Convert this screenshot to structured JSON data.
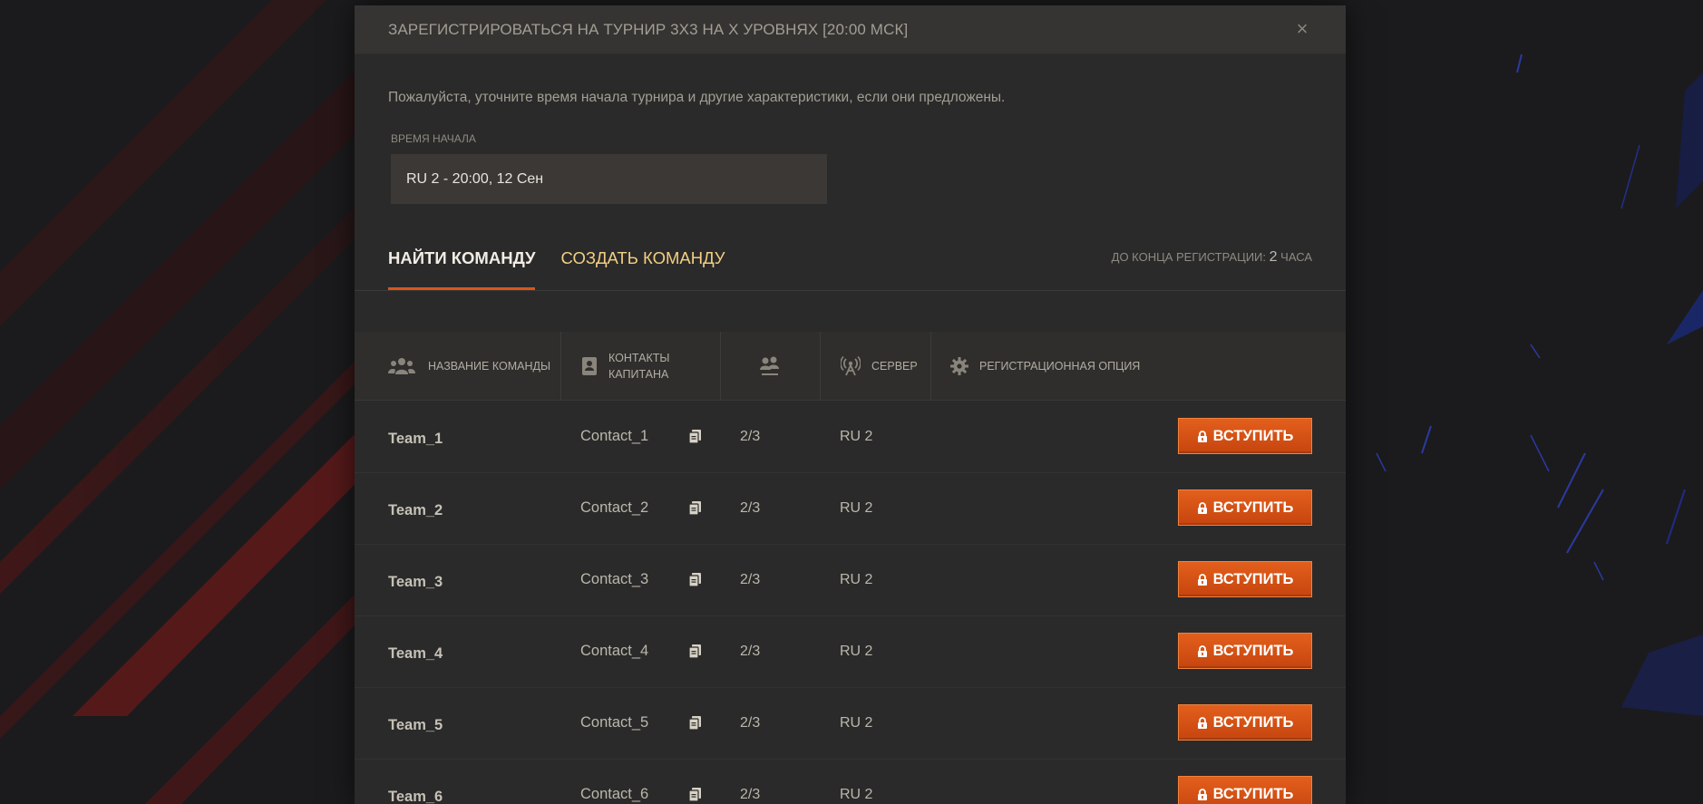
{
  "modal": {
    "title": "ЗАРЕГИСТРИРОВАТЬСЯ НА ТУРНИР 3Х3 НА X УРОВНЯХ [20:00 МСК]",
    "close_glyph": "×",
    "intro": "Пожалуйста, уточните время начала турнира и другие характеристики, если они предложены.",
    "start_time": {
      "label": "ВРЕМЯ НАЧАЛА",
      "value": "RU 2 - 20:00, 12 Сен"
    }
  },
  "tabs": [
    {
      "label": "НАЙТИ КОМАНДУ",
      "active": true
    },
    {
      "label": "СОЗДАТЬ КОМАНДУ",
      "active": false
    }
  ],
  "registration": {
    "prefix": "ДО КОНЦА РЕГИСТРАЦИИ:",
    "number": "2",
    "unit": "ЧАСА"
  },
  "table": {
    "columns": {
      "team_name": "НАЗВАНИЕ КОМАНДЫ",
      "captain_line1": "КОНТАКТЫ",
      "captain_line2": "КАПИТАНА",
      "server": "СЕРВЕР",
      "reg_option": "РЕГИСТРАЦИОННАЯ ОПЦИЯ"
    },
    "join_label": "ВСТУПИТЬ",
    "rows": [
      {
        "team": "Team_1",
        "contact": "Contact_1",
        "count": "2/3",
        "server": "RU 2"
      },
      {
        "team": "Team_2",
        "contact": "Contact_2",
        "count": "2/3",
        "server": "RU 2"
      },
      {
        "team": "Team_3",
        "contact": "Contact_3",
        "count": "2/3",
        "server": "RU 2"
      },
      {
        "team": "Team_4",
        "contact": "Contact_4",
        "count": "2/3",
        "server": "RU 2"
      },
      {
        "team": "Team_5",
        "contact": "Contact_5",
        "count": "2/3",
        "server": "RU 2"
      },
      {
        "team": "Team_6",
        "contact": "Contact_6",
        "count": "2/3",
        "server": "RU 2"
      }
    ]
  },
  "colors": {
    "accent": "#d9551c",
    "button": "#d4501a",
    "tab_inactive": "#f2cf82"
  },
  "icons": [
    "close-icon",
    "team-icon",
    "contact-card-icon",
    "players-icon",
    "server-antenna-icon",
    "gear-icon",
    "copy-icon",
    "lock-icon"
  ]
}
